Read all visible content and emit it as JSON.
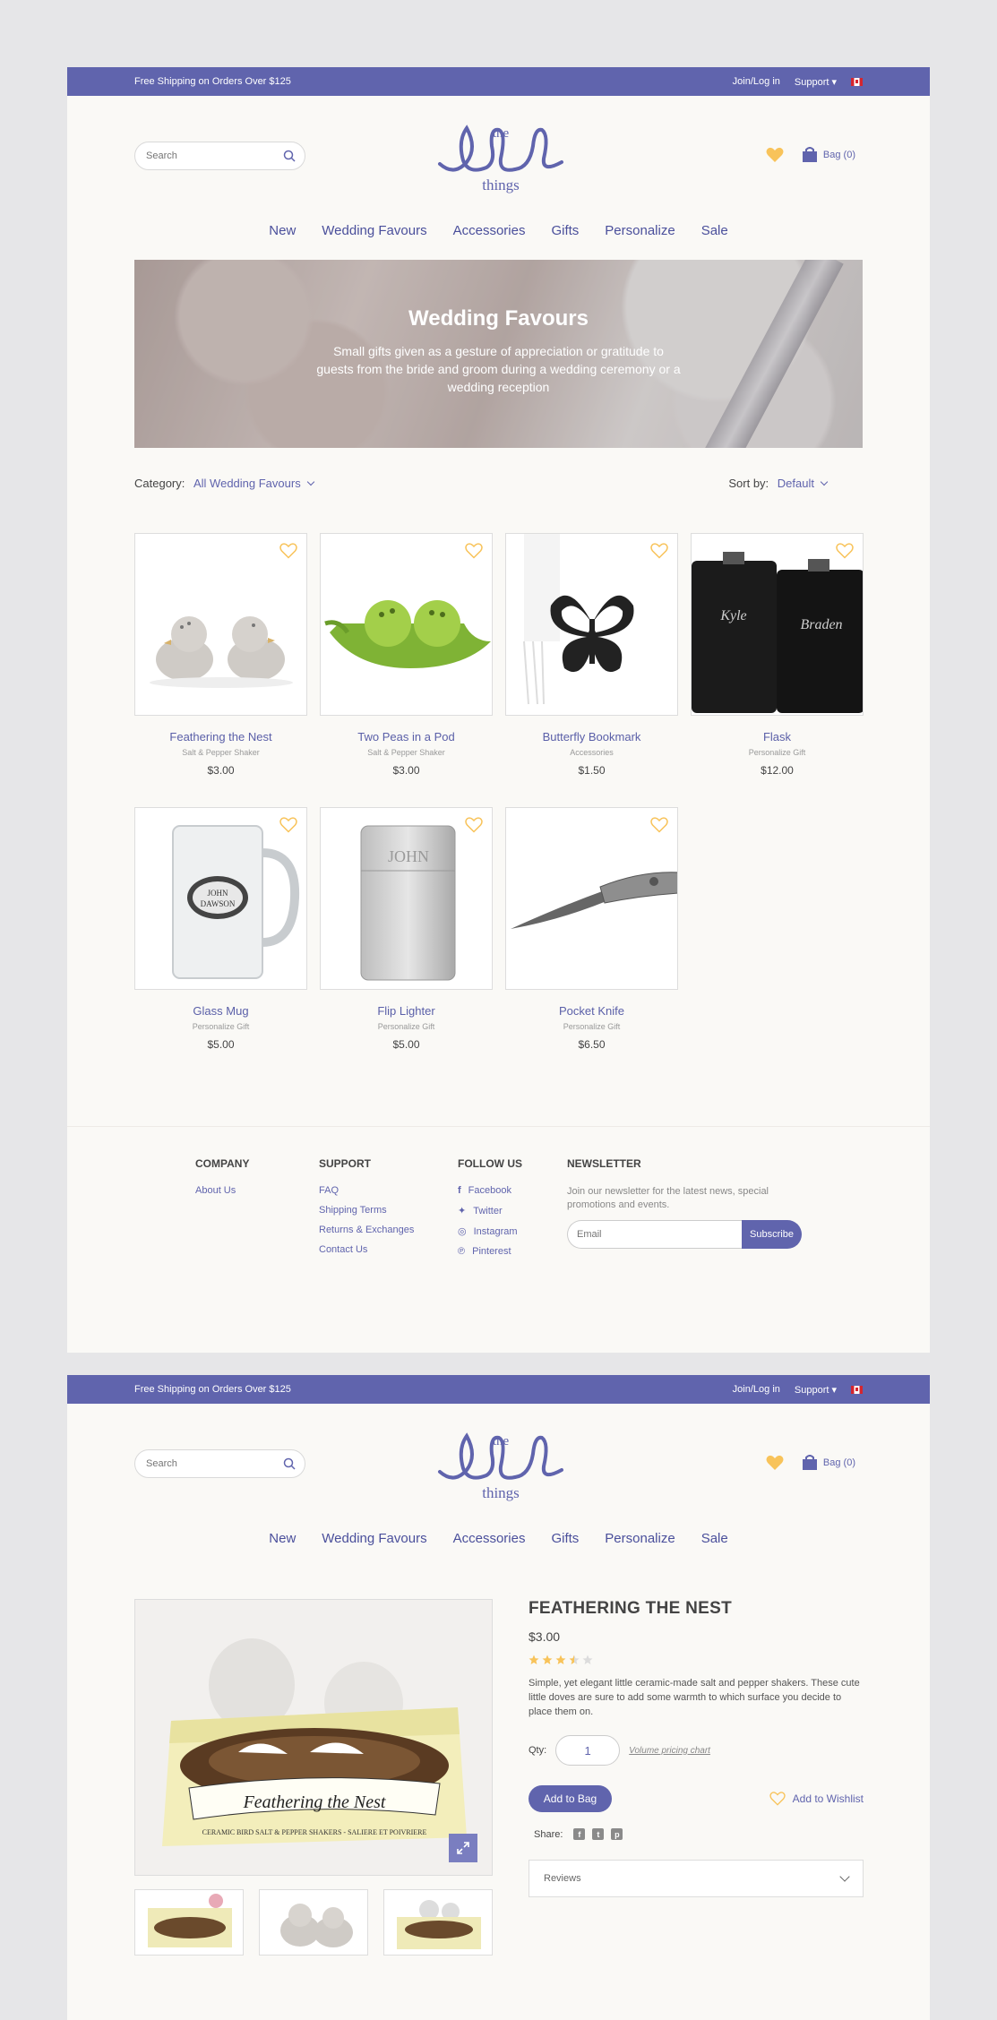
{
  "topbar": {
    "promo": "Free Shipping on Orders Over $125",
    "login": "Join/Log in",
    "support": "Support"
  },
  "search": {
    "placeholder": "Search"
  },
  "logo": {
    "the": "the",
    "things": "things"
  },
  "bag": {
    "label": "Bag (0)"
  },
  "nav": [
    "New",
    "Wedding Favours",
    "Accessories",
    "Gifts",
    "Personalize",
    "Sale"
  ],
  "hero": {
    "title": "Wedding Favours",
    "subtitle": "Small gifts given as a gesture of appreciation or gratitude to guests from the bride and groom during a wedding ceremony or a wedding reception"
  },
  "filters": {
    "category_label": "Category:",
    "category_value": "All Wedding Favours",
    "sort_label": "Sort by:",
    "sort_value": "Default"
  },
  "products": [
    {
      "name": "Feathering the Nest",
      "category": "Salt & Pepper Shaker",
      "price": "$3.00"
    },
    {
      "name": "Two Peas in a Pod",
      "category": "Salt & Pepper Shaker",
      "price": "$3.00"
    },
    {
      "name": "Butterfly Bookmark",
      "category": "Accessories",
      "price": "$1.50"
    },
    {
      "name": "Flask",
      "category": "Personalize Gift",
      "price": "$12.00"
    },
    {
      "name": "Glass Mug",
      "category": "Personalize Gift",
      "price": "$5.00"
    },
    {
      "name": "Flip Lighter",
      "category": "Personalize Gift",
      "price": "$5.00"
    },
    {
      "name": "Pocket Knife",
      "category": "Personalize Gift",
      "price": "$6.50"
    }
  ],
  "product_images": {
    "flask_left": "Kyle",
    "flask_right": "Braden",
    "mug_plate_1": "JOHN",
    "mug_plate_2": "DAWSON",
    "lighter": "JOHN"
  },
  "footer": {
    "company": {
      "title": "COMPANY",
      "links": [
        "About Us"
      ]
    },
    "support": {
      "title": "SUPPORT",
      "links": [
        "FAQ",
        "Shipping Terms",
        "Returns & Exchanges",
        "Contact Us"
      ]
    },
    "follow": {
      "title": "FOLLOW US",
      "links": [
        "Facebook",
        "Twitter",
        "Instagram",
        "Pinterest"
      ]
    },
    "newsletter": {
      "title": "NEWSLETTER",
      "text": "Join our newsletter for the latest news, special promotions and events.",
      "placeholder": "Email",
      "button": "Subscribe"
    }
  },
  "product_detail": {
    "title": "FEATHERING THE NEST",
    "price": "$3.00",
    "rating": 3.5,
    "description": "Simple, yet elegant little ceramic-made salt and pepper shakers. These cute little doves are sure to add some warmth to which surface you decide to place them on.",
    "qty_label": "Qty:",
    "qty_value": "1",
    "pricing_link": "Volume pricing chart",
    "add_to_bag": "Add to Bag",
    "add_to_wishlist": "Add to Wishlist",
    "share_label": "Share:",
    "reviews_label": "Reviews",
    "box_text": "Feathering the Nest",
    "box_subtext": "CERAMIC BIRD SALT & PEPPER SHAKERS - SALIERE ET POIVRIERE"
  },
  "colors": {
    "brand": "#6064ad",
    "heart": "#f8c35a",
    "background": "#faf9f6"
  }
}
